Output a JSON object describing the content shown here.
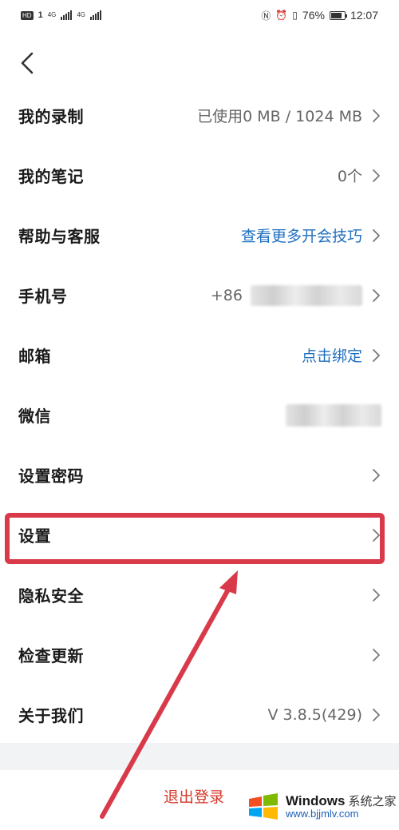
{
  "status_bar": {
    "hd_label": "HD",
    "sim1_label": "1",
    "net1": "4G",
    "net2": "4G",
    "battery_percent": "76%",
    "time": "12:07"
  },
  "header": {
    "back_icon": "chevron-left-icon"
  },
  "rows": [
    {
      "label": "我的录制",
      "value": "已使用0 MB / 1024 MB",
      "value_color": "#666666",
      "chevron": true
    },
    {
      "label": "我的笔记",
      "value": "0个",
      "value_color": "#666666",
      "chevron": true
    },
    {
      "label": "帮助与客服",
      "value": "查看更多开会技巧",
      "value_color": "#1f6fbf",
      "chevron": true
    },
    {
      "label": "手机号",
      "value": "+86",
      "value_color": "#666666",
      "chevron": true,
      "redacted": true
    },
    {
      "label": "邮箱",
      "value": "点击绑定",
      "value_color": "#1f6fbf",
      "chevron": true
    },
    {
      "label": "微信",
      "value": "",
      "chevron": false,
      "redacted": true
    },
    {
      "label": "设置密码",
      "value": "",
      "chevron": true
    },
    {
      "label": "设置",
      "value": "",
      "chevron": true
    },
    {
      "label": "隐私安全",
      "value": "",
      "chevron": true
    },
    {
      "label": "检查更新",
      "value": "",
      "chevron": true
    },
    {
      "label": "关于我们",
      "value": "V 3.8.5(429)",
      "value_color": "#666666",
      "chevron": true
    }
  ],
  "logout_label": "退出登录",
  "annotation": {
    "highlight_color": "#d83a4a",
    "highlighted_item": "设置"
  },
  "watermark": {
    "title": "Windows",
    "subtitle": "系统之家",
    "url": "www.bjjmlv.com"
  },
  "colors": {
    "accent_blue": "#1f6fbf",
    "logout_red": "#d63a2b"
  }
}
